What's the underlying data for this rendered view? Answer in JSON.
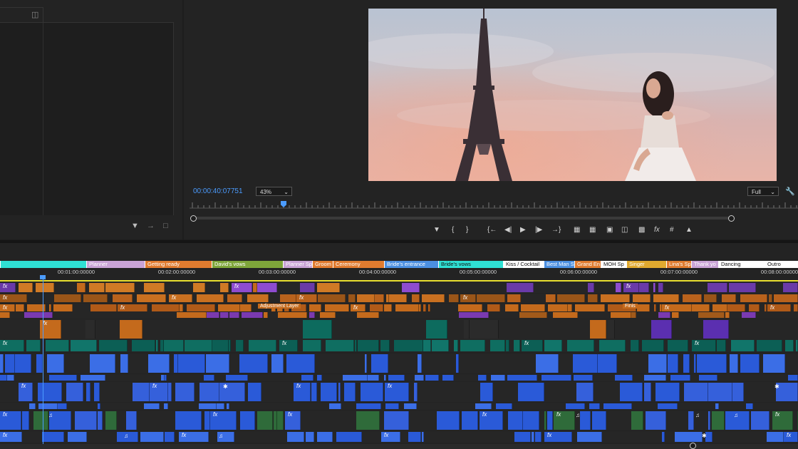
{
  "program_monitor": {
    "timecode": "00:00:40:07751",
    "zoom_value": "43%",
    "resolution_value": "Full",
    "playhead_fraction": 0.17
  },
  "icons": {
    "panel_menu": "panel-menu-icon",
    "filter": "filter-icon",
    "settings": "wrench-icon"
  },
  "timeline": {
    "markers": [
      {
        "label": "",
        "color": "#2fe0d4"
      },
      {
        "label": "Planner",
        "color": "#c9a3d6"
      },
      {
        "label": "Getting ready",
        "color": "#e07b2f"
      },
      {
        "label": "David's vows",
        "color": "#7ea53a"
      },
      {
        "label": "Planner Sp",
        "color": "#c9a3d6"
      },
      {
        "label": "Groom",
        "color": "#e07b2f"
      },
      {
        "label": "Ceremony",
        "color": "#e07b2f"
      },
      {
        "label": "Bride's entrance",
        "color": "#4b8fe0"
      },
      {
        "label": "Bride's vows",
        "color": "#2fe0d4"
      },
      {
        "label": "Kiss / Cocktail",
        "color": "#ffffff"
      },
      {
        "label": "Best Man S",
        "color": "#4b8fe0"
      },
      {
        "label": "Grand En",
        "color": "#e07b2f"
      },
      {
        "label": "MOH Sp",
        "color": "#ffffff"
      },
      {
        "label": "Singer",
        "color": "#e0a92f"
      },
      {
        "label": "Lina's Sp",
        "color": "#e07b2f"
      },
      {
        "label": "Thank yo",
        "color": "#c9a3d6"
      },
      {
        "label": "Dancing",
        "color": "#ffffff"
      },
      {
        "label": "Outro",
        "color": "#ffffff"
      }
    ],
    "ruler_labels": [
      "00:01:00:00000",
      "00:02:00:00000",
      "00:03:00:00000",
      "00:04:00:00000",
      "00:05:00:00000",
      "00:06:00:00000",
      "00:07:00:00000",
      "00:08:00:00000"
    ],
    "adjustment_layer_label": "Adjustment Layer",
    "finish_label": "Finis",
    "fx_label": "fx",
    "music_note": "♫",
    "star": "✱"
  }
}
